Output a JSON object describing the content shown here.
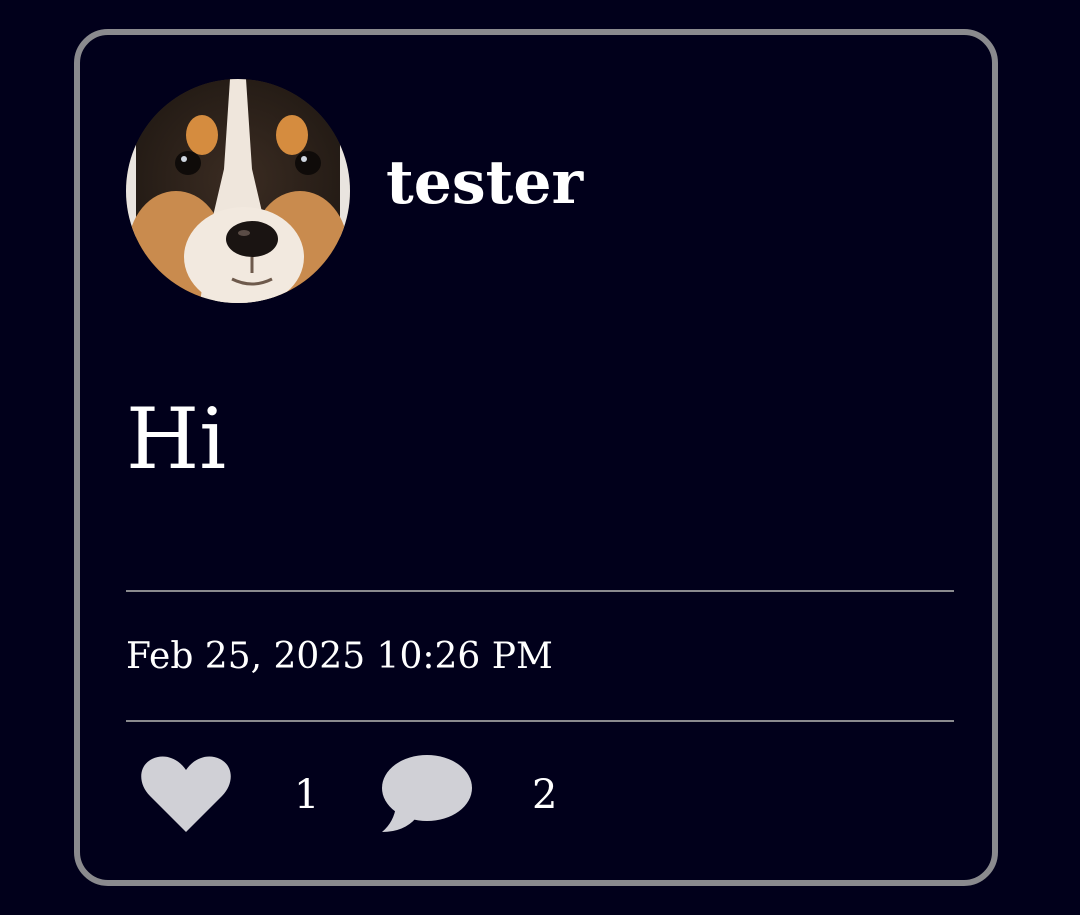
{
  "post": {
    "username": "tester",
    "text": "Hi",
    "timestamp": "Feb 25, 2025 10:26 PM",
    "likes": "1",
    "comments": "2"
  },
  "icons": {
    "like": "heart-icon",
    "comment": "speech-bubble-icon"
  },
  "colors": {
    "background": "#01001b",
    "card_border": "#8a8a8e",
    "icon_fill": "#d0d0d6",
    "text": "#ffffff"
  }
}
